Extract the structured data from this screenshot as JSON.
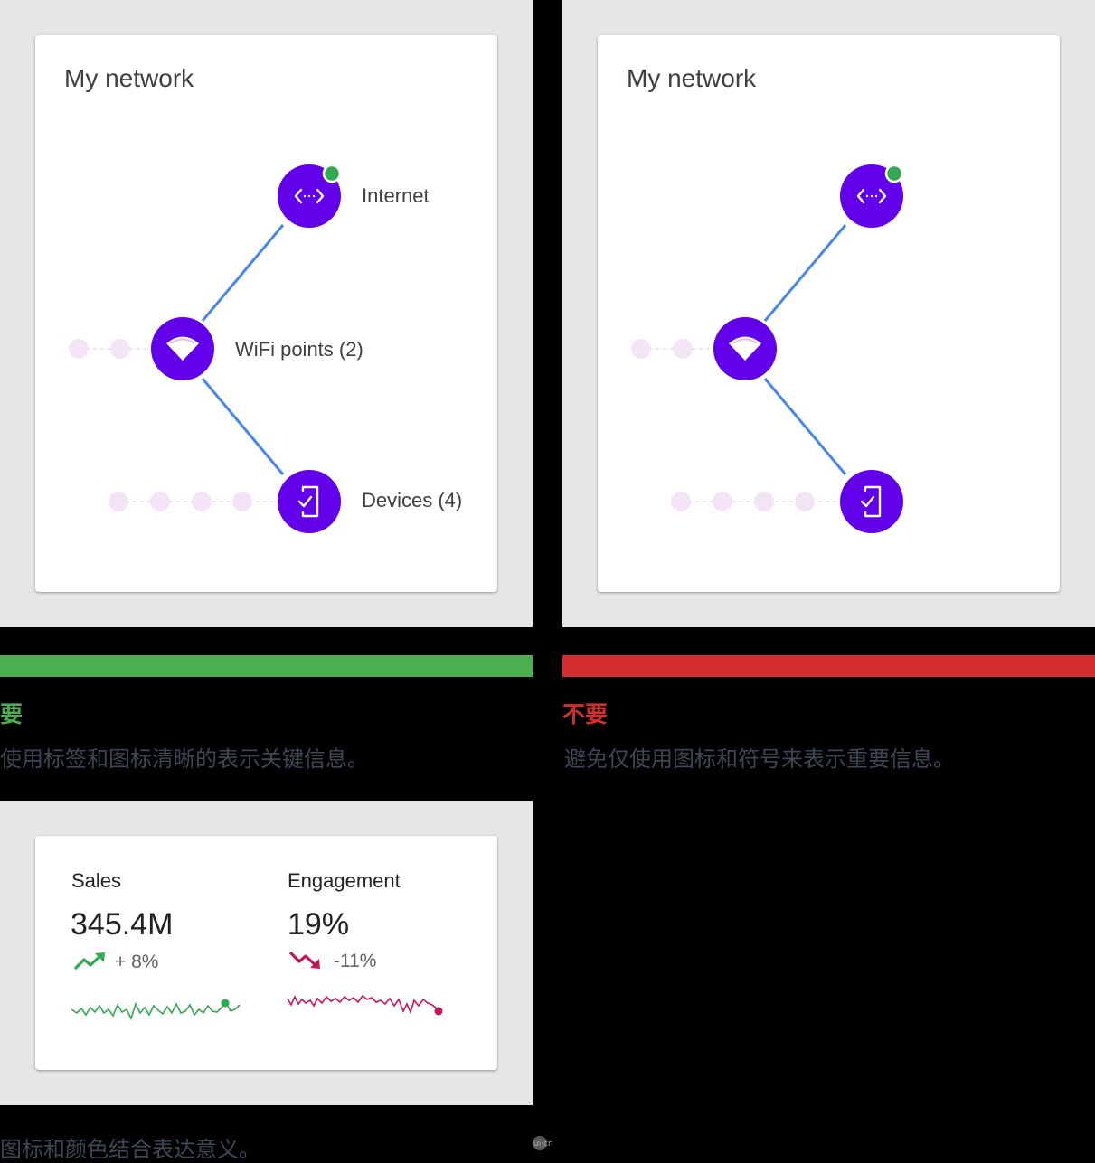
{
  "colors": {
    "accent": "#6200ea",
    "line": "#4a86e8",
    "status_online": "#34a853",
    "dot_faded": "#f3e5f5",
    "do": "#4caf50",
    "dont": "#d32f2f",
    "trend_up": "#34a853",
    "trend_down": "#c2185b",
    "description_text": "#3e4756"
  },
  "do_example": {
    "card_title": "My network",
    "nodes": [
      {
        "name": "internet",
        "label": "Internet",
        "icon": "code-brackets-icon"
      },
      {
        "name": "wifi",
        "label": "WiFi points (2)",
        "icon": "wifi-icon"
      },
      {
        "name": "devices",
        "label": "Devices (4)",
        "icon": "phone-check-icon"
      }
    ]
  },
  "dont_example": {
    "card_title": "My network"
  },
  "do_verdict": {
    "label": "要",
    "description": "使用标签和图标清晰的表示关键信息。"
  },
  "dont_verdict": {
    "label": "不要",
    "description": "避免仅使用图标和符号来表示重要信息。"
  },
  "metrics_example": {
    "sales": {
      "title": "Sales",
      "value": "345.4M",
      "change": "+ 8%",
      "trend_icon": "trending-up-icon"
    },
    "engagement": {
      "title": "Engagement",
      "value": "19%",
      "change": "-11%",
      "trend_icon": "trending-down-icon"
    },
    "description": "图标和颜色结合表达意义。"
  },
  "watermark": "ui·cn"
}
